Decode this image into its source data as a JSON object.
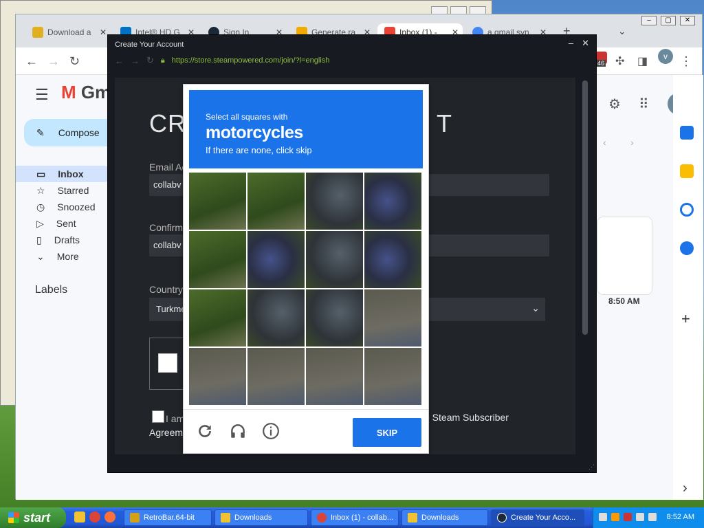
{
  "chrome": {
    "tabs": [
      {
        "label": "Download a",
        "fav": "#e0b020"
      },
      {
        "label": "Intel® HD G",
        "fav": "#0071c5"
      },
      {
        "label": "Sign In",
        "fav": "#1b2838"
      },
      {
        "label": "Generate ra",
        "fav": "#f2a900"
      },
      {
        "label": "Inbox (1) -",
        "fav": "#ea4335"
      },
      {
        "label": "a gmail syn",
        "fav": "#4285f4"
      }
    ],
    "new_tab": "+",
    "profile_initial": "v",
    "ext_badge": "46"
  },
  "gmail": {
    "logo": "Gm",
    "compose": "Compose",
    "nav": [
      {
        "label": "Inbox",
        "icon": "inbox-icon",
        "glyph": "▭"
      },
      {
        "label": "Starred",
        "icon": "star-icon",
        "glyph": "☆"
      },
      {
        "label": "Snoozed",
        "icon": "clock-icon",
        "glyph": "◷"
      },
      {
        "label": "Sent",
        "icon": "send-icon",
        "glyph": "▷"
      },
      {
        "label": "Drafts",
        "icon": "draft-icon",
        "glyph": "▯"
      },
      {
        "label": "More",
        "icon": "chevron-down-icon",
        "glyph": "⌄"
      }
    ],
    "labels": "Labels",
    "time": "8:50 AM",
    "avatar": "V"
  },
  "steam": {
    "title": "Create Your Account",
    "url": "https://store.steampowered.com/join/?l=english",
    "heading_left": "CR",
    "heading_right": "T",
    "email_label": "Email Ac",
    "email_value": "collabv",
    "confirm_label": "Confirm",
    "confirm_value": "collabv",
    "country_label": "Country",
    "country_value": "Turkme",
    "agree_prefix": "I am",
    "agree_suffix": "e Steam Subscriber",
    "agree_line2": "Agreem"
  },
  "captcha": {
    "line1": "Select all squares with",
    "target": "motorcycles",
    "line3": "If there are none, click skip",
    "skip": "SKIP"
  },
  "taskbar": {
    "start": "start",
    "items": [
      {
        "label": "RetroBar.64-bit"
      },
      {
        "label": "Downloads"
      },
      {
        "label": "Inbox (1) - collab..."
      },
      {
        "label": "Downloads"
      },
      {
        "label": "Create Your Acco..."
      }
    ],
    "clock": "8:52 AM"
  }
}
